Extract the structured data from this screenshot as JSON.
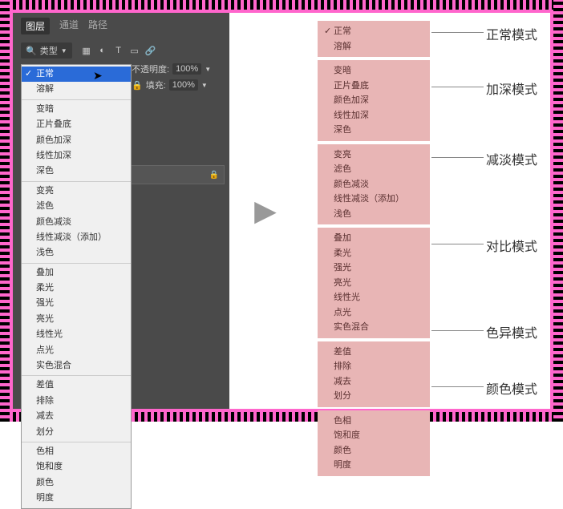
{
  "tabs": {
    "layers": "图层",
    "channels": "通道",
    "paths": "路径"
  },
  "toolbar": {
    "type_label": "类型",
    "opacity_label": "不透明度:",
    "opacity_value": "100%",
    "fill_label": "填充:",
    "fill_value": "100%"
  },
  "blend_modes": {
    "group1": [
      "正常",
      "溶解"
    ],
    "group2": [
      "变暗",
      "正片叠底",
      "颜色加深",
      "线性加深",
      "深色"
    ],
    "group3": [
      "变亮",
      "滤色",
      "颜色减淡",
      "线性减淡（添加）",
      "浅色"
    ],
    "group4": [
      "叠加",
      "柔光",
      "强光",
      "亮光",
      "线性光",
      "点光",
      "实色混合"
    ],
    "group5": [
      "差值",
      "排除",
      "减去",
      "划分"
    ],
    "group6": [
      "色相",
      "饱和度",
      "颜色",
      "明度"
    ]
  },
  "categories": {
    "group1": {
      "label": "正常模式",
      "items": [
        "正常",
        "溶解"
      ]
    },
    "group2": {
      "label": "加深模式",
      "items": [
        "变暗",
        "正片叠底",
        "颜色加深",
        "线性加深",
        "深色"
      ]
    },
    "group3": {
      "label": "减淡模式",
      "items": [
        "变亮",
        "滤色",
        "颜色减淡",
        "线性减淡（添加）",
        "浅色"
      ]
    },
    "group4": {
      "label": "对比模式",
      "items": [
        "叠加",
        "柔光",
        "强光",
        "亮光",
        "线性光",
        "点光",
        "实色混合"
      ]
    },
    "group5": {
      "label": "色异模式",
      "items": [
        "差值",
        "排除",
        "减去",
        "划分"
      ]
    },
    "group6": {
      "label": "颜色模式",
      "items": [
        "色相",
        "饱和度",
        "颜色",
        "明度"
      ]
    }
  },
  "selected_mode": "正常",
  "icons": {
    "search": "🔍",
    "image": "▦",
    "circle": "◐",
    "text": "T",
    "rect": "▭",
    "link": "🔗",
    "lock": "🔒"
  }
}
